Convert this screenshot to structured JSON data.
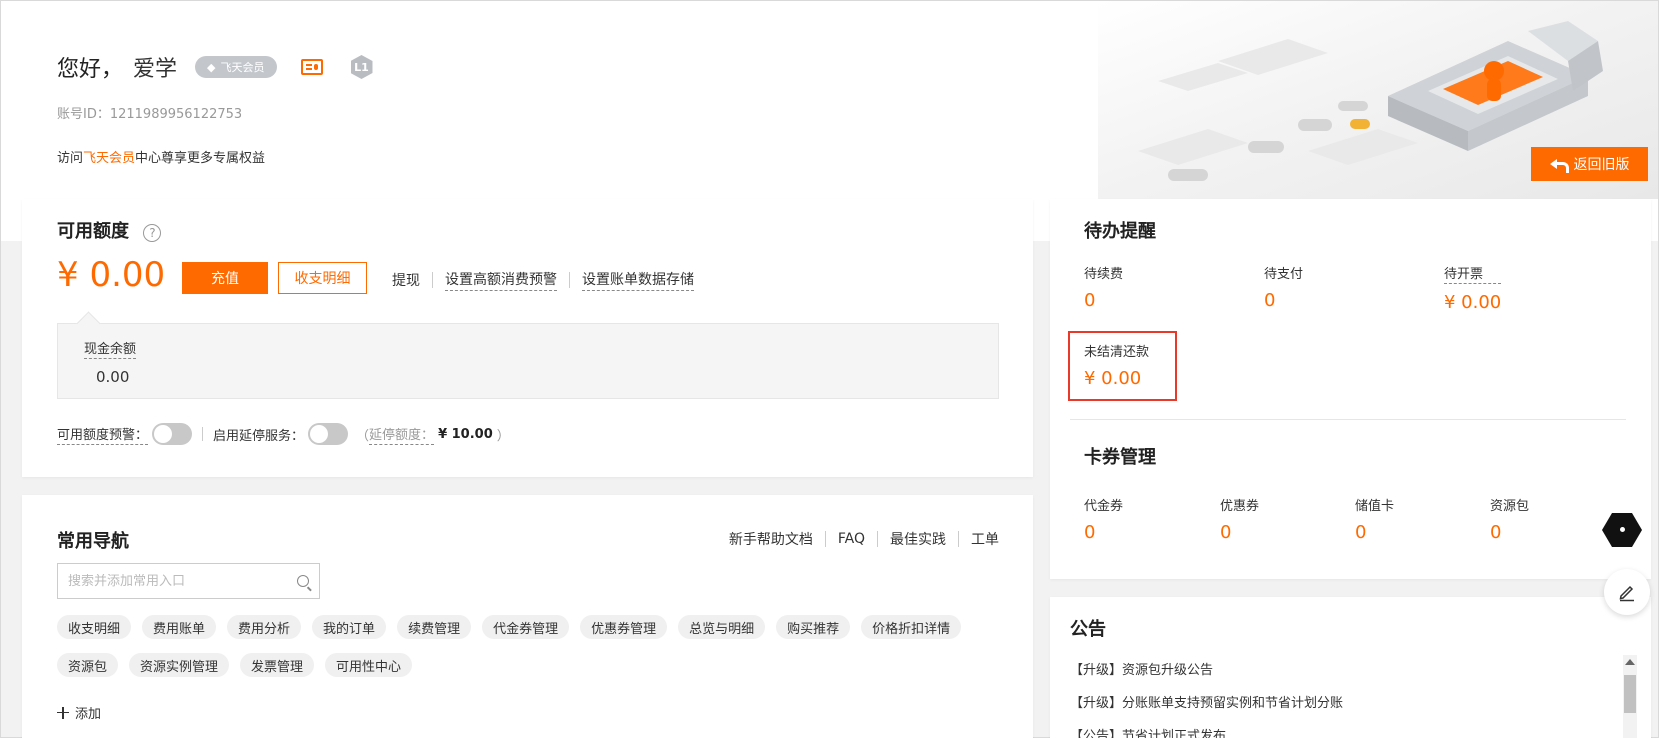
{
  "header": {
    "greeting": "您好，",
    "username_visible": "爱学",
    "member_badge": "飞天会员",
    "level_badge": "L1",
    "account_id": "账号ID：1211989956122753",
    "visit_prefix": "访问",
    "visit_link": "飞天会员",
    "visit_suffix": "中心尊享更多专属权益",
    "return_label": "返回旧版"
  },
  "balance": {
    "title": "可用额度",
    "help_glyph": "?",
    "amount": "¥ 0.00",
    "recharge_label": "充值",
    "statement_label": "收支明细",
    "links": [
      "提现",
      "设置高额消费预警",
      "设置账单数据存储"
    ],
    "cash_label": "现金余额",
    "cash_value": "0.00",
    "alert_label": "可用额度预警：",
    "delay_label": "启用延停服务：",
    "delay_open": "（",
    "delay_quota_label": "延停额度：",
    "delay_quota_value": "¥ 10.00",
    "delay_close": "）"
  },
  "nav": {
    "title": "常用导航",
    "links": [
      "新手帮助文档",
      "FAQ",
      "最佳实践",
      "工单"
    ],
    "search_placeholder": "搜索并添加常用入口",
    "tags": [
      "收支明细",
      "费用账单",
      "费用分析",
      "我的订单",
      "续费管理",
      "代金券管理",
      "优惠券管理",
      "总览与明细",
      "购买推荐",
      "价格折扣详情",
      "资源包",
      "资源实例管理",
      "发票管理",
      "可用性中心"
    ],
    "add_label": "添加"
  },
  "todo": {
    "title": "待办提醒",
    "items": [
      {
        "label": "待续费",
        "value": "0"
      },
      {
        "label": "待支付",
        "value": "0"
      },
      {
        "label": "待开票",
        "value": "¥ 0.00"
      },
      {
        "label": "未结清还款",
        "value": "¥ 0.00"
      }
    ]
  },
  "coupons": {
    "title": "卡券管理",
    "items": [
      {
        "label": "代金券",
        "value": "0"
      },
      {
        "label": "优惠券",
        "value": "0"
      },
      {
        "label": "储值卡",
        "value": "0"
      },
      {
        "label": "资源包",
        "value": "0"
      }
    ]
  },
  "notices": {
    "title": "公告",
    "items": [
      "【升级】资源包升级公告",
      "【升级】分账账单支持预留实例和节省计划分账",
      "【公告】节省计划正式发布"
    ]
  },
  "colors": {
    "accent": "#ff6a00",
    "highlight": "#e8392a"
  }
}
